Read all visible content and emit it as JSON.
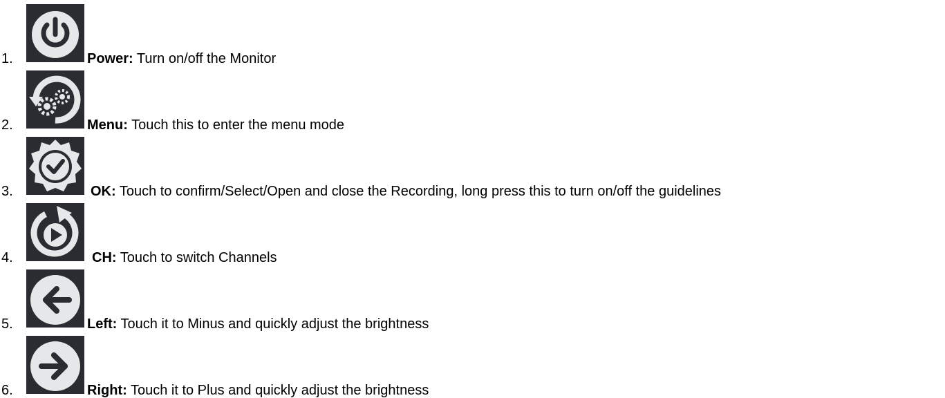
{
  "items": [
    {
      "number": "1.",
      "icon": "power-icon",
      "label": "Power:",
      "description": " Turn on/off the Monitor"
    },
    {
      "number": "2.",
      "icon": "menu-gears-icon",
      "label": "Menu:",
      "description": " Touch this to enter the menu mode"
    },
    {
      "number": "3.",
      "icon": "ok-check-icon",
      "label": "OK:",
      "description": " Touch to confirm/Select/Open and close the Recording, long press this to turn on/off the guidelines"
    },
    {
      "number": "4.",
      "icon": "channel-switch-icon",
      "label": "CH:",
      "description": " Touch to switch Channels"
    },
    {
      "number": "5.",
      "icon": "left-arrow-icon",
      "label": "Left:",
      "description": " Touch it to Minus and quickly adjust the brightness"
    },
    {
      "number": "6.",
      "icon": "right-arrow-icon",
      "label": "Right:",
      "description": " Touch it to Plus and quickly adjust the brightness"
    }
  ],
  "colors": {
    "icon_background": "#2a2c31",
    "icon_foreground": "#e6e7e9",
    "text": "#000000"
  }
}
